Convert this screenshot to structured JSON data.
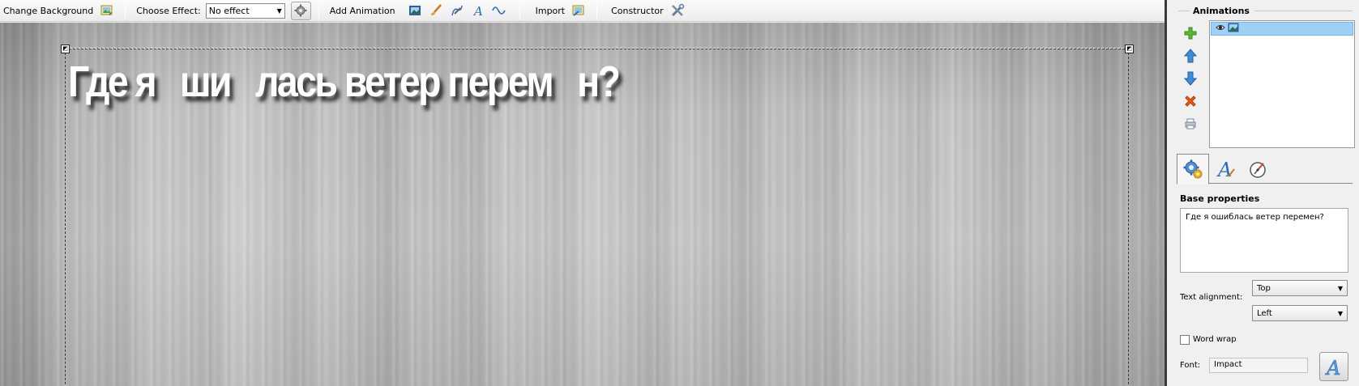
{
  "toolbar": {
    "change_background_label": "Change Background",
    "choose_effect_label": "Choose Effect:",
    "effect_value": "No effect",
    "add_animation_label": "Add Animation",
    "import_label": "Import",
    "constructor_label": "Constructor"
  },
  "canvas": {
    "text": "Где я   ши   лась ветер перем   н?"
  },
  "panel": {
    "animations_title": "Animations",
    "animation_items": [
      {
        "icon": "image-icon"
      }
    ],
    "side_buttons": [
      "add-icon",
      "move-up-icon",
      "move-down-icon",
      "delete-icon",
      "print-icon"
    ],
    "tabs": [
      "settings-tab-icon",
      "text-tab-icon",
      "timing-tab-icon"
    ],
    "base_properties_title": "Base properties",
    "text_value": "Где я ошиблась ветер перемен?",
    "text_alignment_label": "Text alignment:",
    "vertical_alignment": "Top",
    "horizontal_alignment": "Left",
    "word_wrap_label": "Word wrap",
    "word_wrap_checked": false,
    "font_label": "Font:",
    "font_value": "Impact"
  },
  "colors": {
    "selection_blue": "#9fd0f5",
    "canvas_text": "#ffffff"
  }
}
